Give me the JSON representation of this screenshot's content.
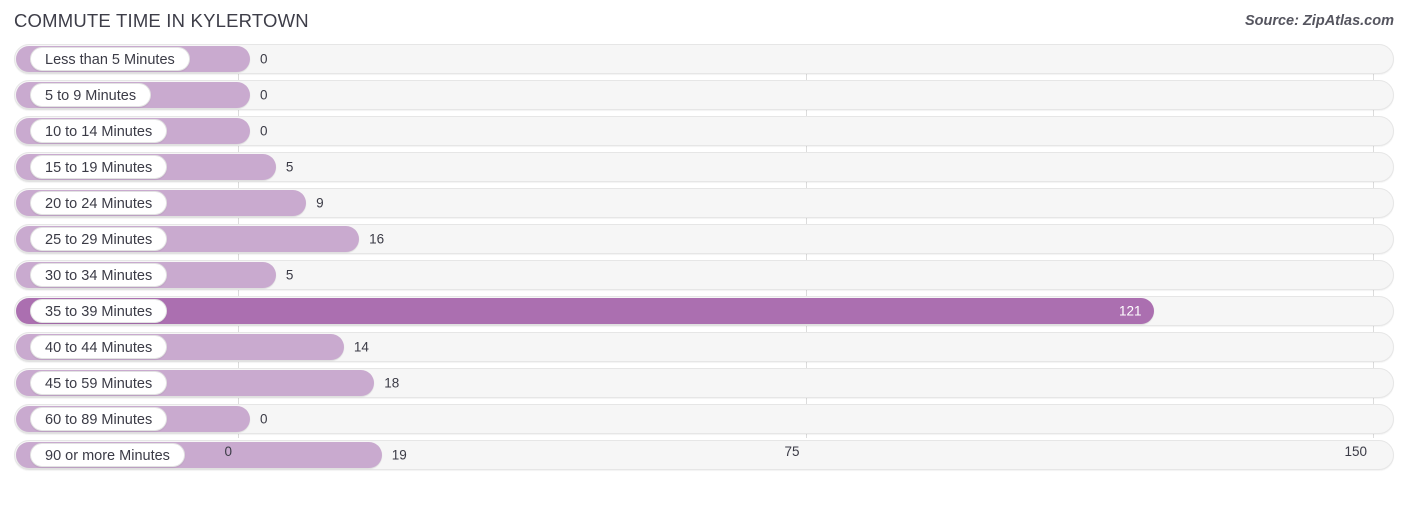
{
  "header": {
    "title": "COMMUTE TIME IN KYLERTOWN",
    "source": "Source: ZipAtlas.com"
  },
  "colors": {
    "bar": "#c9aacf",
    "bar_highlight": "#ab6fb0",
    "track": "#f6f6f6",
    "gridline": "#dcdcdc",
    "text": "#3b3b46"
  },
  "chart_data": {
    "type": "bar",
    "orientation": "horizontal",
    "title": "COMMUTE TIME IN KYLERTOWN",
    "xlabel": "",
    "ylabel": "",
    "xlim": [
      0,
      150
    ],
    "xticks": [
      0,
      75,
      150
    ],
    "xtick_labels": [
      "0",
      "75",
      "150"
    ],
    "grid": true,
    "legend": false,
    "categories": [
      "Less than 5 Minutes",
      "5 to 9 Minutes",
      "10 to 14 Minutes",
      "15 to 19 Minutes",
      "20 to 24 Minutes",
      "25 to 29 Minutes",
      "30 to 34 Minutes",
      "35 to 39 Minutes",
      "40 to 44 Minutes",
      "45 to 59 Minutes",
      "60 to 89 Minutes",
      "90 or more Minutes"
    ],
    "values": [
      0,
      0,
      0,
      5,
      9,
      16,
      5,
      121,
      14,
      18,
      0,
      19
    ],
    "value_labels": [
      "0",
      "0",
      "0",
      "5",
      "9",
      "16",
      "5",
      "121",
      "14",
      "18",
      "0",
      "19"
    ],
    "highlight_index": 7
  },
  "rows": [
    {
      "label": "Less than 5 Minutes",
      "value": 0,
      "value_label": "0",
      "highlight": false
    },
    {
      "label": "5 to 9 Minutes",
      "value": 0,
      "value_label": "0",
      "highlight": false
    },
    {
      "label": "10 to 14 Minutes",
      "value": 0,
      "value_label": "0",
      "highlight": false
    },
    {
      "label": "15 to 19 Minutes",
      "value": 5,
      "value_label": "5",
      "highlight": false
    },
    {
      "label": "20 to 24 Minutes",
      "value": 9,
      "value_label": "9",
      "highlight": false
    },
    {
      "label": "25 to 29 Minutes",
      "value": 16,
      "value_label": "16",
      "highlight": false
    },
    {
      "label": "30 to 34 Minutes",
      "value": 5,
      "value_label": "5",
      "highlight": false
    },
    {
      "label": "35 to 39 Minutes",
      "value": 121,
      "value_label": "121",
      "highlight": true
    },
    {
      "label": "40 to 44 Minutes",
      "value": 14,
      "value_label": "14",
      "highlight": false
    },
    {
      "label": "45 to 59 Minutes",
      "value": 18,
      "value_label": "18",
      "highlight": false
    },
    {
      "label": "60 to 89 Minutes",
      "value": 0,
      "value_label": "0",
      "highlight": false
    },
    {
      "label": "90 or more Minutes",
      "value": 19,
      "value_label": "19",
      "highlight": false
    }
  ],
  "axis": {
    "ticks": [
      {
        "label": "0",
        "value": 0
      },
      {
        "label": "75",
        "value": 75
      },
      {
        "label": "150",
        "value": 150
      }
    ]
  }
}
